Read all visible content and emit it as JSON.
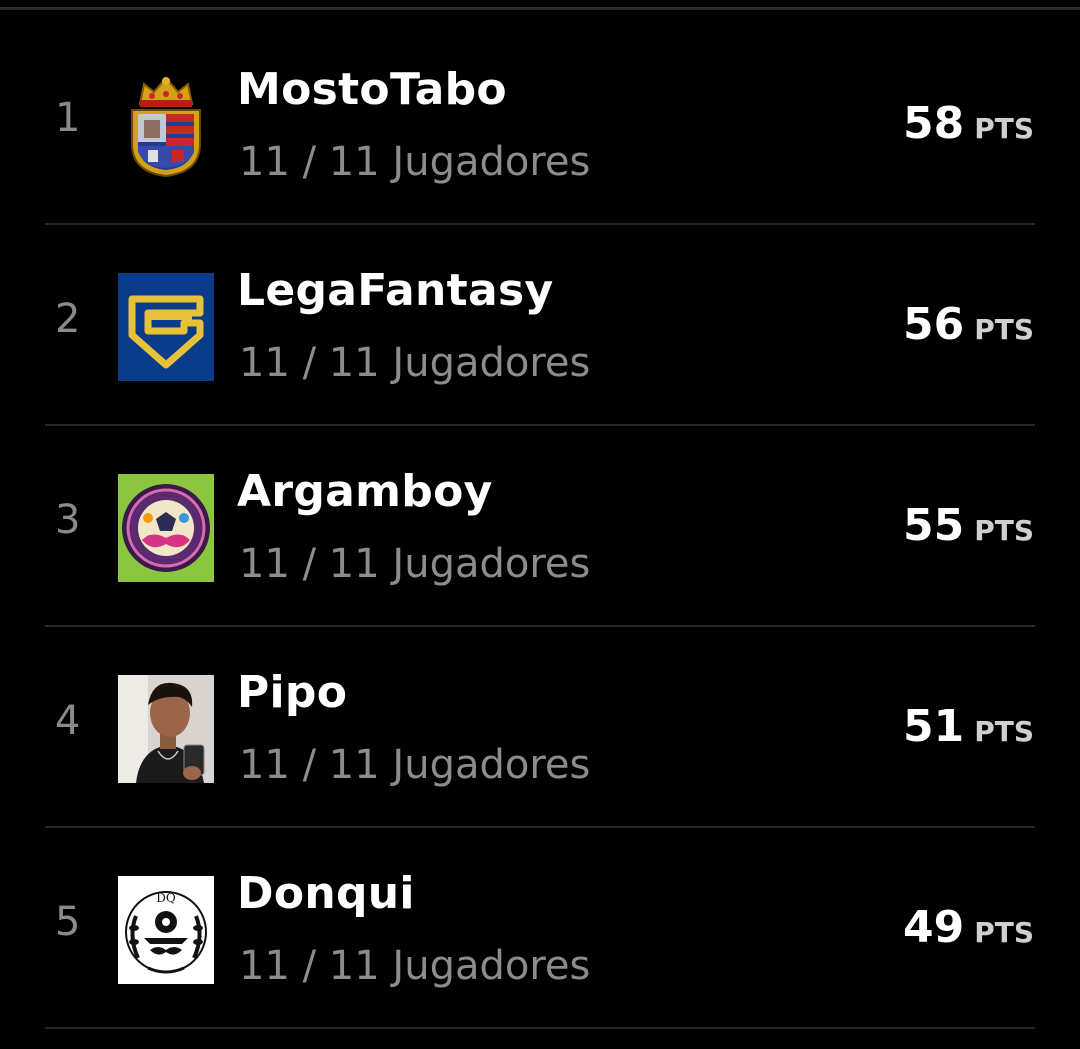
{
  "ranking": {
    "teams": [
      {
        "position": "1",
        "name": "MostoTabo",
        "players": "11 / 11 Jugadores",
        "points": "58",
        "unit": "PTS",
        "avatar": "crest-shield-icon"
      },
      {
        "position": "2",
        "name": "LegaFantasy",
        "players": "11 / 11 Jugadores",
        "points": "56",
        "unit": "PTS",
        "avatar": "lf-shield-logo-icon"
      },
      {
        "position": "3",
        "name": "Argamboy",
        "players": "11 / 11 Jugadores",
        "points": "55",
        "unit": "PTS",
        "avatar": "ball-mustache-logo-icon"
      },
      {
        "position": "4",
        "name": "Pipo",
        "players": "11 / 11 Jugadores",
        "points": "51",
        "unit": "PTS",
        "avatar": "user-photo-icon"
      },
      {
        "position": "5",
        "name": "Donqui",
        "players": "11 / 11 Jugadores",
        "points": "49",
        "unit": "PTS",
        "avatar": "dq-laurel-logo-icon"
      }
    ],
    "logo_texts": {
      "donqui": "DQ"
    }
  },
  "colors": {
    "background": "#000000",
    "name": "#ffffff",
    "secondary": "#8c8c8c",
    "divider": "#262626",
    "legafantasy_blue": "#0b3c8c",
    "legafantasy_gold": "#e5c23a",
    "argamboy_green": "#8cc63f"
  }
}
